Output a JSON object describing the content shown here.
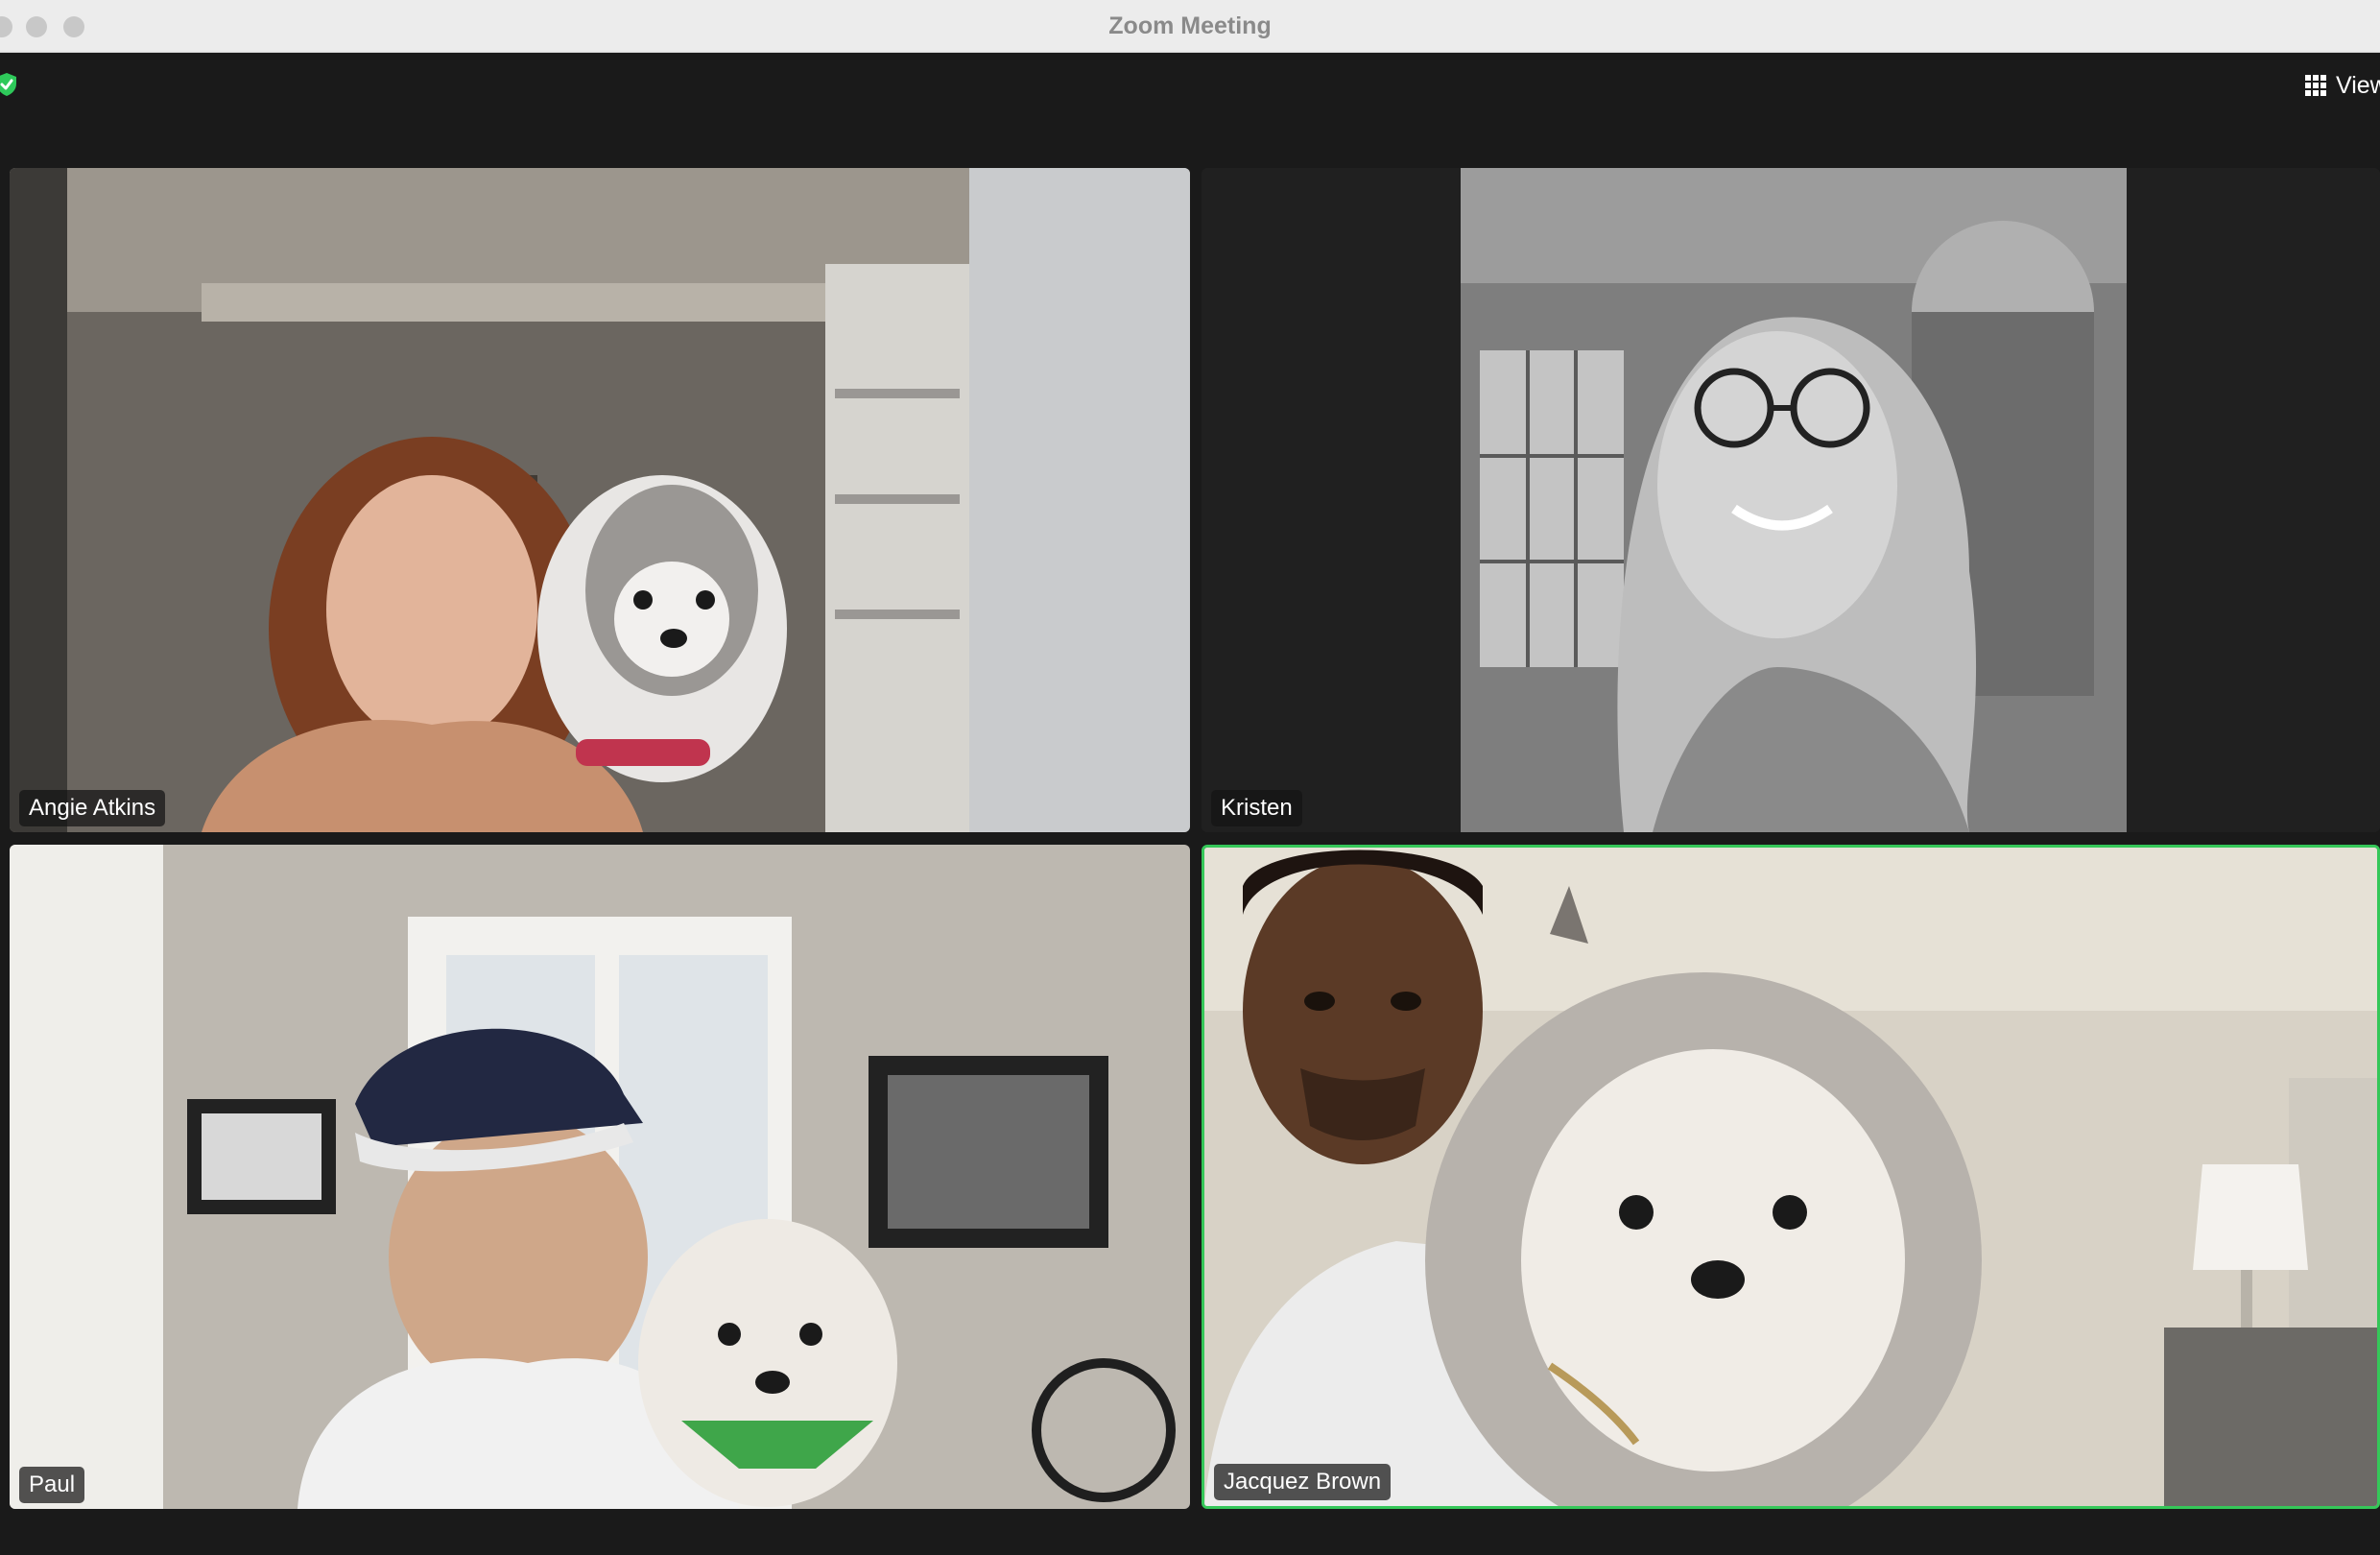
{
  "window": {
    "title": "Zoom Meeting",
    "controls": [
      "close",
      "minimize",
      "zoom"
    ]
  },
  "toolbar": {
    "security_icon": "shield-check-icon",
    "view_icon": "grid-icon",
    "view_label": "View"
  },
  "participants": [
    {
      "name": "Angie Atkins",
      "active_speaker": false
    },
    {
      "name": "Kristen",
      "active_speaker": false
    },
    {
      "name": "Paul",
      "active_speaker": false
    },
    {
      "name": "Jacquez Brown",
      "active_speaker": true
    }
  ],
  "colors": {
    "active_speaker_border": "#35c759",
    "background": "#1a1a1a"
  }
}
